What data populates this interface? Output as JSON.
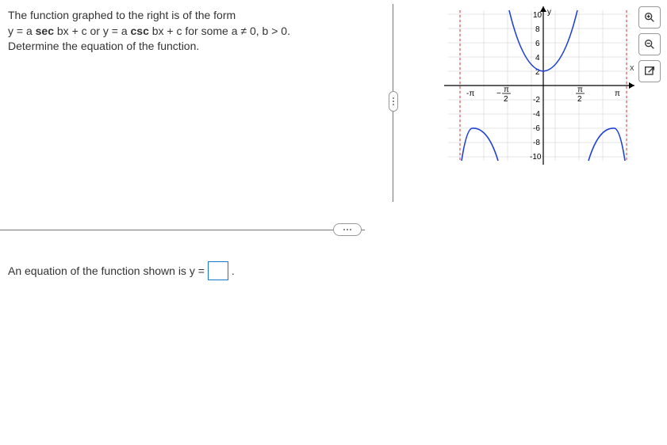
{
  "question": {
    "line1_pre": "The function graphed to the right is of the form",
    "form1_prefix": "y = a ",
    "form1_bold": "sec",
    "form1_mid": " bx + c or y = a ",
    "form1_bold2": "csc",
    "form1_suffix": " bx + c for some a ≠ 0, b > 0.",
    "line3": "Determine the equation of the function."
  },
  "answer": {
    "prompt_prefix": "An equation of the function shown is y = ",
    "prompt_suffix": ".",
    "input_value": ""
  },
  "graph": {
    "y_label": "y",
    "x_label": "x",
    "y_ticks": [
      "10",
      "8",
      "6",
      "4",
      "2",
      "-2",
      "-4",
      "-6",
      "-8",
      "-10"
    ],
    "x_ticks": [
      "-π",
      "-π/2",
      "π/2",
      "π"
    ]
  },
  "tools": {
    "zoom_in": "zoom-in",
    "zoom_out": "zoom-out",
    "open_new": "open-new"
  },
  "chart_data": {
    "type": "line",
    "title": "",
    "xlabel": "x",
    "ylabel": "y",
    "ylim": [
      -10,
      10
    ],
    "xlim": [
      -3.5,
      3.5
    ],
    "x_tick_labels": [
      "-π",
      "-π/2",
      "0",
      "π/2",
      "π"
    ],
    "y_tick_values": [
      -10,
      -8,
      -6,
      -4,
      -2,
      0,
      2,
      4,
      6,
      8,
      10
    ],
    "series": [
      {
        "name": "secant-like curve",
        "description": "Central vertex near (0,2), upward branches asymptotic near x=±π/2; lower branches with vertex near (-π,-6) and (π,-6) asymptotic near x=±π/2 and x=±3π/2"
      }
    ],
    "asymptotes_x": [
      -4.712,
      -1.571,
      1.571,
      4.712
    ]
  }
}
